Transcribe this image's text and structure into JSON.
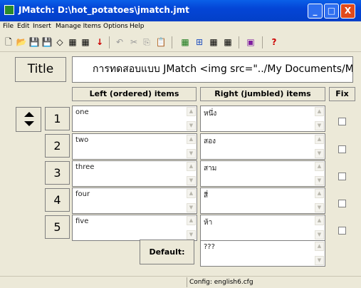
{
  "window": {
    "title": "JMatch: D:\\hot_potatoes\\jmatch.jmt",
    "minimize": "_",
    "maximize": "□",
    "close": "X"
  },
  "menu": [
    "File",
    "Edit",
    "Insert",
    "Manage Items",
    "Options",
    "Help"
  ],
  "toolbar": {
    "icons": [
      "new-file-icon",
      "open-folder-icon",
      "save-icon",
      "save-as-icon",
      "diamond-icon",
      "web-page-icon",
      "web-page-2-icon",
      "red-arrow-down-icon",
      "undo-icon",
      "cut-icon",
      "copy-icon",
      "paste-icon",
      "drag-drop-icon",
      "browser-icon",
      "export-icon",
      "export-2-icon",
      "config-icon",
      "help-icon"
    ],
    "glyphs": [
      "🗋",
      "📂",
      "💾",
      "💾",
      "◇",
      "▦",
      "▦",
      "↓",
      "↶",
      "✂",
      "⎘",
      "📋",
      "▦",
      "⊞",
      "▦",
      "▦",
      "▣",
      "?"
    ]
  },
  "title_label": "Title",
  "title_value": "การทดสอบแบบ JMatch <img src=\"../My Documents/My",
  "headers": {
    "left": "Left (ordered) items",
    "right": "Right (jumbled) items",
    "fix": "Fix"
  },
  "rows": [
    {
      "num": "1",
      "left": "one",
      "right": "หนึ่ง"
    },
    {
      "num": "2",
      "left": "two",
      "right": "สอง"
    },
    {
      "num": "3",
      "left": "three",
      "right": "สาม"
    },
    {
      "num": "4",
      "left": "four",
      "right": "สี่"
    },
    {
      "num": "5",
      "left": "five",
      "right": "ห้า"
    }
  ],
  "default_label": "Default:",
  "default_value": "???",
  "scroll_glyphs": {
    "up": "▲",
    "down": "▼"
  },
  "status": "Config: english6.cfg"
}
